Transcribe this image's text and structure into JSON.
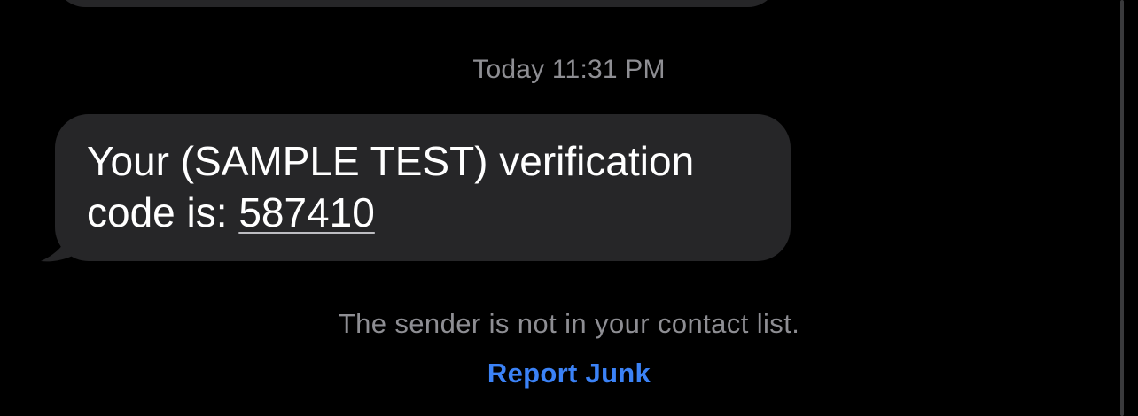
{
  "conversation": {
    "timestamp": "Today 11:31 PM",
    "message": {
      "text_prefix": "Your (SAMPLE TEST) verification code is: ",
      "code": "587410"
    },
    "notice": "The sender is not in your contact list.",
    "report_junk_label": "Report Junk"
  },
  "colors": {
    "background": "#000000",
    "bubble": "#262628",
    "secondary_text": "#8e8e93",
    "link": "#3b82f6"
  }
}
